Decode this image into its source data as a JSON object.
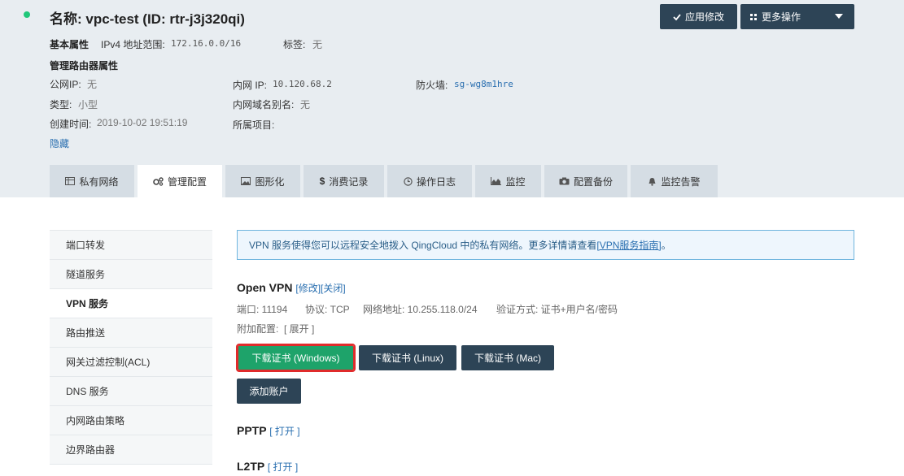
{
  "header": {
    "title": "名称: vpc-test (ID: rtr-j3j320qi)",
    "apply_label": "应用修改",
    "more_label": "更多操作",
    "basic_props_label": "基本属性",
    "ipv4_label": "IPv4 地址范围:",
    "ipv4_value": "172.16.0.0/16",
    "tags_label": "标签:",
    "tags_value": "无",
    "router_props_label": "管理路由器属性",
    "public_ip_label": "公网IP:",
    "public_ip_value": "无",
    "private_ip_label": "内网 IP:",
    "private_ip_value": "10.120.68.2",
    "firewall_label": "防火墙:",
    "firewall_value": "sg-wg8m1hre",
    "type_label": "类型:",
    "type_value": "小型",
    "alias_label": "内网域名别名:",
    "alias_value": "无",
    "created_label": "创建时间:",
    "created_value": "2019-10-02 19:51:19",
    "project_label": "所属项目:",
    "hide_label": "隐藏"
  },
  "tabs": [
    {
      "label": "私有网络",
      "icon": "table-icon"
    },
    {
      "label": "管理配置",
      "icon": "cogs-icon"
    },
    {
      "label": "图形化",
      "icon": "image-icon"
    },
    {
      "label": "消费记录",
      "icon": "dollar-icon"
    },
    {
      "label": "操作日志",
      "icon": "clock-icon"
    },
    {
      "label": "监控",
      "icon": "chart-icon"
    },
    {
      "label": "配置备份",
      "icon": "camera-icon"
    },
    {
      "label": "监控告警",
      "icon": "bell-icon"
    }
  ],
  "sidebar": {
    "items": [
      {
        "label": "端口转发"
      },
      {
        "label": "隧道服务"
      },
      {
        "label": "VPN 服务"
      },
      {
        "label": "路由推送"
      },
      {
        "label": "网关过滤控制(ACL)"
      },
      {
        "label": "DNS 服务"
      },
      {
        "label": "内网路由策略"
      },
      {
        "label": "边界路由器"
      }
    ]
  },
  "main": {
    "info_text": "VPN 服务使得您可以远程安全地拨入 QingCloud 中的私有网络。更多详情请查看",
    "info_link": "[VPN服务指南]",
    "info_end": "。",
    "openvpn": {
      "title": "Open VPN",
      "bracket_open": "[",
      "modify": "修改",
      "separator": "][",
      "close": "关闭",
      "bracket_close": "]",
      "port": "端口: 11194",
      "protocol": "协议: TCP",
      "network": "网络地址: 10.255.118.0/24",
      "auth": "验证方式: 证书+用户名/密码",
      "extra_label": "附加配置:",
      "expand": "[ 展开 ]",
      "dl_windows": "下载证书 (Windows)",
      "dl_linux": "下载证书 (Linux)",
      "dl_mac": "下载证书 (Mac)",
      "add_account": "添加账户"
    },
    "pptp": {
      "title": "PPTP",
      "open": "[ 打开 ]"
    },
    "l2tp": {
      "title": "L2TP",
      "open": "[ 打开 ]"
    }
  },
  "colors": {
    "accent_green": "#1ea36a",
    "dark_button": "#2d4456",
    "status": "#20c77a",
    "highlight": "#e02b2b"
  }
}
